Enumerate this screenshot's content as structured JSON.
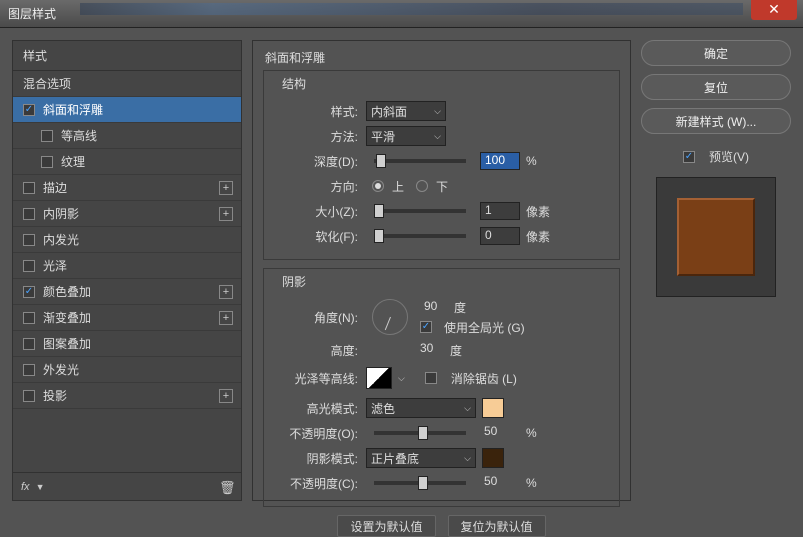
{
  "window": {
    "title": "图层样式"
  },
  "sidebar": {
    "header": "样式",
    "blend_options": "混合选项",
    "items": [
      {
        "label": "斜面和浮雕",
        "checked": true,
        "selected": true,
        "expand": false,
        "indent": false
      },
      {
        "label": "等高线",
        "checked": false,
        "selected": false,
        "expand": false,
        "indent": true
      },
      {
        "label": "纹理",
        "checked": false,
        "selected": false,
        "expand": false,
        "indent": true
      },
      {
        "label": "描边",
        "checked": false,
        "selected": false,
        "expand": true,
        "indent": false
      },
      {
        "label": "内阴影",
        "checked": false,
        "selected": false,
        "expand": true,
        "indent": false
      },
      {
        "label": "内发光",
        "checked": false,
        "selected": false,
        "expand": false,
        "indent": false
      },
      {
        "label": "光泽",
        "checked": false,
        "selected": false,
        "expand": false,
        "indent": false
      },
      {
        "label": "颜色叠加",
        "checked": true,
        "selected": false,
        "expand": true,
        "indent": false
      },
      {
        "label": "渐变叠加",
        "checked": false,
        "selected": false,
        "expand": true,
        "indent": false
      },
      {
        "label": "图案叠加",
        "checked": false,
        "selected": false,
        "expand": false,
        "indent": false
      },
      {
        "label": "外发光",
        "checked": false,
        "selected": false,
        "expand": false,
        "indent": false
      },
      {
        "label": "投影",
        "checked": false,
        "selected": false,
        "expand": true,
        "indent": false
      }
    ],
    "fx_label": "fx"
  },
  "main": {
    "title": "斜面和浮雕",
    "structure": {
      "legend": "结构",
      "style_label": "样式:",
      "style_value": "内斜面",
      "method_label": "方法:",
      "method_value": "平滑",
      "depth_label": "深度(D):",
      "depth_value": "100",
      "depth_unit": "%",
      "direction_label": "方向:",
      "dir_up": "上",
      "dir_down": "下",
      "size_label": "大小(Z):",
      "size_value": "1",
      "size_unit": "像素",
      "soften_label": "软化(F):",
      "soften_value": "0",
      "soften_unit": "像素"
    },
    "shading": {
      "legend": "阴影",
      "angle_label": "角度(N):",
      "angle_value": "90",
      "angle_unit": "度",
      "global_label": "使用全局光 (G)",
      "altitude_label": "高度:",
      "altitude_value": "30",
      "altitude_unit": "度",
      "gloss_label": "光泽等高线:",
      "antialias_label": "消除锯齿 (L)",
      "highlight_mode_label": "高光模式:",
      "highlight_mode_value": "滤色",
      "highlight_opacity_label": "不透明度(O):",
      "highlight_opacity_value": "50",
      "highlight_opacity_unit": "%",
      "shadow_mode_label": "阴影模式:",
      "shadow_mode_value": "正片叠底",
      "shadow_opacity_label": "不透明度(C):",
      "shadow_opacity_value": "50",
      "shadow_opacity_unit": "%",
      "highlight_color": "#f7cc96",
      "shadow_color": "#3a230c"
    },
    "footer": {
      "make_default": "设置为默认值",
      "reset_default": "复位为默认值"
    }
  },
  "right": {
    "ok": "确定",
    "cancel": "复位",
    "new_style": "新建样式 (W)...",
    "preview_label": "预览(V)"
  }
}
